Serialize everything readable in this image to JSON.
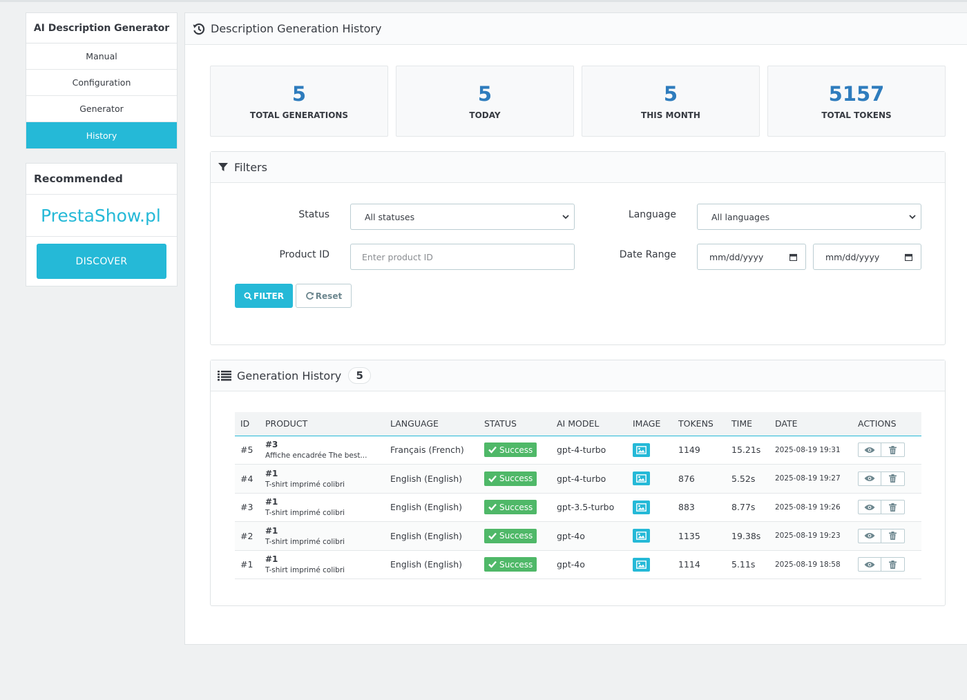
{
  "sidebar": {
    "title": "AI Description Generator",
    "items": [
      {
        "label": "Manual",
        "active": false
      },
      {
        "label": "Configuration",
        "active": false
      },
      {
        "label": "Generator",
        "active": false
      },
      {
        "label": "History",
        "active": true
      }
    ],
    "recommended": {
      "title": "Recommended",
      "brand": "PrestaShow.pl",
      "button": "DISCOVER"
    }
  },
  "main": {
    "title": "Description Generation History",
    "icon": "history-icon"
  },
  "stats": [
    {
      "value": "5",
      "label": "TOTAL GENERATIONS"
    },
    {
      "value": "5",
      "label": "TODAY"
    },
    {
      "value": "5",
      "label": "THIS MONTH"
    },
    {
      "value": "5157",
      "label": "TOTAL TOKENS"
    }
  ],
  "filters": {
    "title": "Filters",
    "status_label": "Status",
    "status_value": "All statuses",
    "language_label": "Language",
    "language_value": "All languages",
    "product_id_label": "Product ID",
    "product_id_placeholder": "Enter product ID",
    "date_range_label": "Date Range",
    "date_from": "mm/dd/yyyy",
    "date_to": "mm/dd/yyyy",
    "filter_button": "FILTER",
    "reset_button": "Reset"
  },
  "history": {
    "title": "Generation History",
    "count": "5",
    "columns": [
      "ID",
      "PRODUCT",
      "LANGUAGE",
      "STATUS",
      "AI MODEL",
      "IMAGE",
      "TOKENS",
      "TIME",
      "DATE",
      "ACTIONS"
    ],
    "rows": [
      {
        "id": "#5",
        "product_id": "#3",
        "product_name": "Affiche encadrée The best...",
        "language": "Français (French)",
        "status": "Success",
        "model": "gpt-4-turbo",
        "tokens": "1149",
        "time": "15.21s",
        "date": "2025-08-19 19:31"
      },
      {
        "id": "#4",
        "product_id": "#1",
        "product_name": "T-shirt imprimé colibri",
        "language": "English (English)",
        "status": "Success",
        "model": "gpt-4-turbo",
        "tokens": "876",
        "time": "5.52s",
        "date": "2025-08-19 19:27"
      },
      {
        "id": "#3",
        "product_id": "#1",
        "product_name": "T-shirt imprimé colibri",
        "language": "English (English)",
        "status": "Success",
        "model": "gpt-3.5-turbo",
        "tokens": "883",
        "time": "8.77s",
        "date": "2025-08-19 19:26"
      },
      {
        "id": "#2",
        "product_id": "#1",
        "product_name": "T-shirt imprimé colibri",
        "language": "English (English)",
        "status": "Success",
        "model": "gpt-4o",
        "tokens": "1135",
        "time": "19.38s",
        "date": "2025-08-19 19:23"
      },
      {
        "id": "#1",
        "product_id": "#1",
        "product_name": "T-shirt imprimé colibri",
        "language": "English (English)",
        "status": "Success",
        "model": "gpt-4o",
        "tokens": "1114",
        "time": "5.11s",
        "date": "2025-08-19 18:58"
      }
    ]
  },
  "colors": {
    "accent": "#25b9d7",
    "stat_value": "#2e7cbd",
    "success": "#4fb868"
  }
}
